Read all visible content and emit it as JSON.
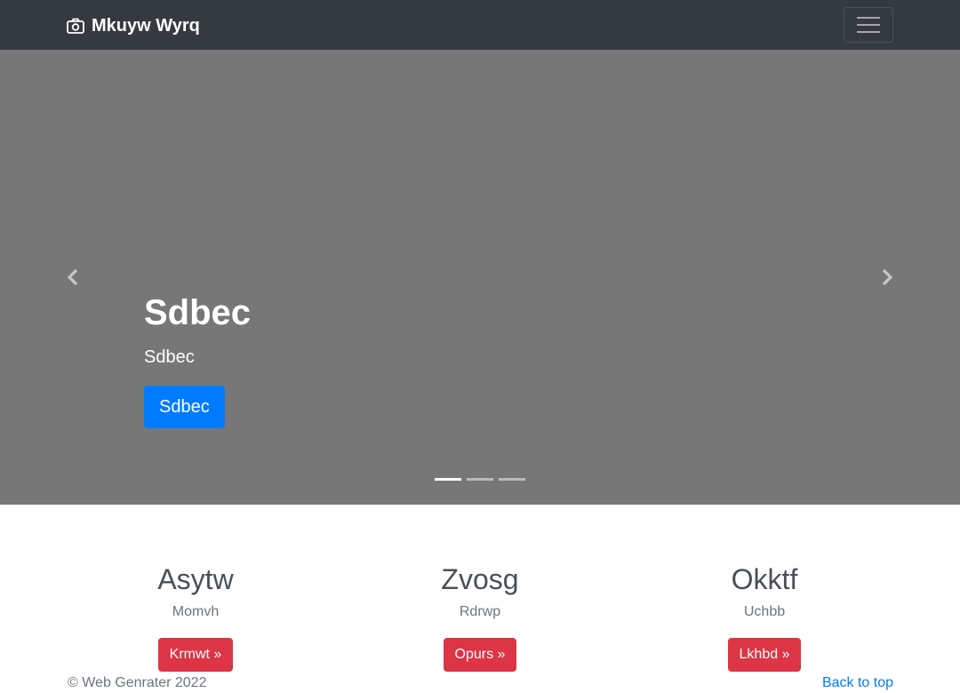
{
  "navbar": {
    "brand": "Mkuyw Wyrq",
    "brand_icon": "camera-icon",
    "toggler_icon": "hamburger-icon"
  },
  "carousel": {
    "title": "Sdbec",
    "text": "Sdbec",
    "button": "Sdbec",
    "indicator_count": 3,
    "active_indicator": 0,
    "prev_icon": "chevron-left-icon",
    "next_icon": "chevron-right-icon"
  },
  "columns": [
    {
      "heading": "Asytw",
      "text": "Momvh",
      "button": "Krmwt »"
    },
    {
      "heading": "Zvosg",
      "text": "Rdrwp",
      "button": "Opurs »"
    },
    {
      "heading": "Okktf",
      "text": "Uchbb",
      "button": "Lkhbd »"
    }
  ],
  "footer": {
    "copyright": "© Web Genrater 2022",
    "back_to_top": "Back to top"
  },
  "colors": {
    "navbar_bg": "#343a40",
    "carousel_bg": "#777777",
    "primary": "#007bff",
    "danger": "#dc3545"
  }
}
